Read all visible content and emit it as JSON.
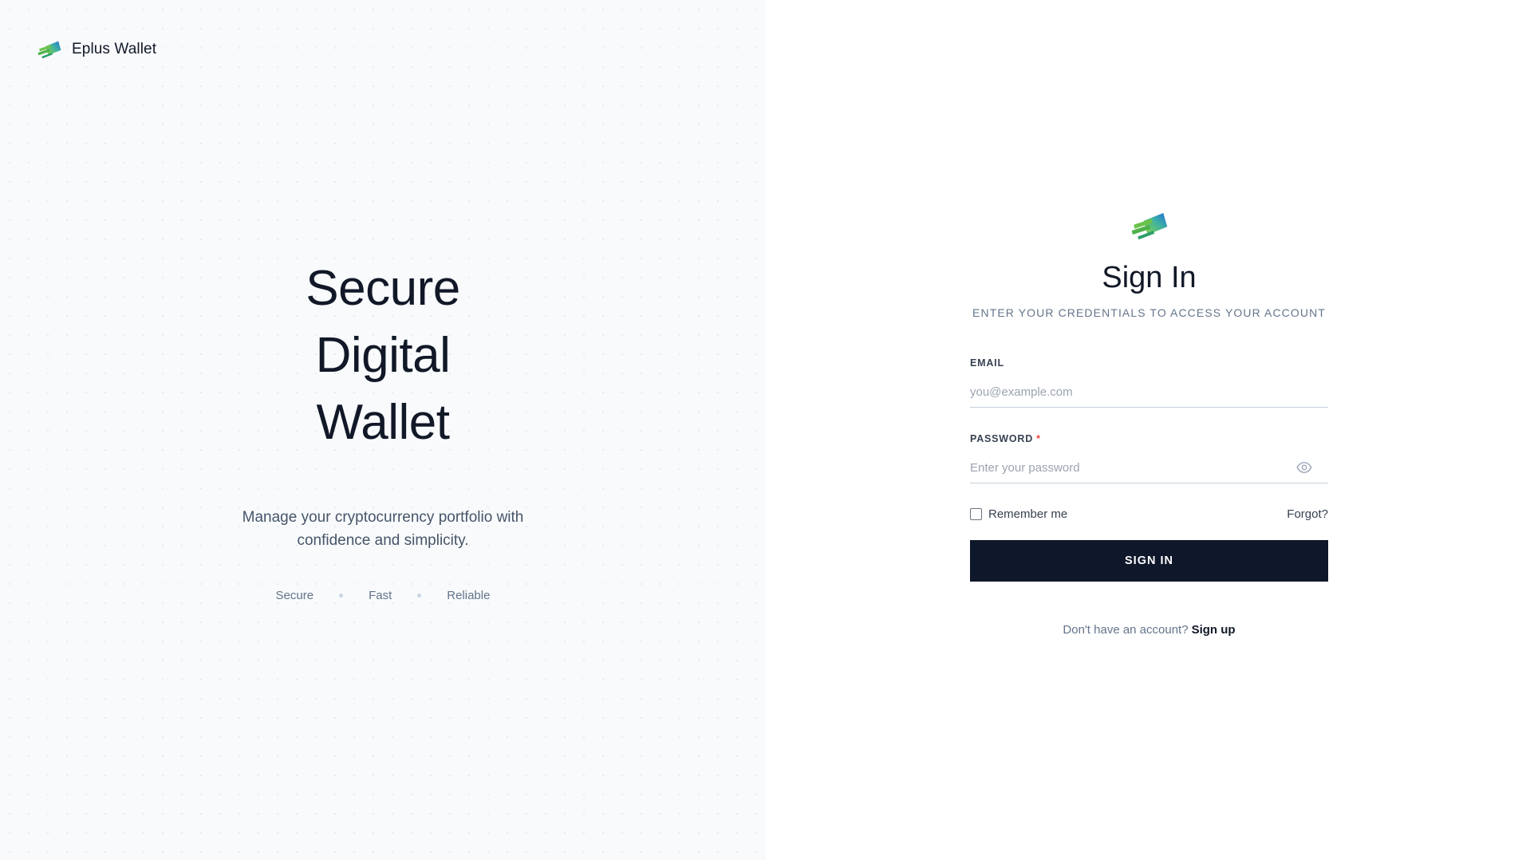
{
  "brand": {
    "name": "Eplus Wallet",
    "logo_icon": "wallet-logo-icon",
    "colors": {
      "green": "#6cc24a",
      "blue": "#1e6fd9",
      "dark": "#0f172a"
    }
  },
  "hero": {
    "title_lines": [
      "Secure",
      "Digital",
      "Wallet"
    ],
    "subtitle": "Manage your cryptocurrency portfolio with confidence and simplicity.",
    "features": [
      "Secure",
      "Fast",
      "Reliable"
    ]
  },
  "signin": {
    "title": "Sign In",
    "subtitle": "ENTER YOUR CREDENTIALS TO ACCESS YOUR ACCOUNT",
    "email": {
      "label": "EMAIL",
      "placeholder": "you@example.com",
      "value": ""
    },
    "password": {
      "label": "PASSWORD",
      "required_mark": "*",
      "placeholder": "Enter your password",
      "value": "",
      "toggle_icon": "eye-icon"
    },
    "remember_label": "Remember me",
    "forgot_label": "Forgot?",
    "submit_label": "SIGN IN",
    "signup_prompt": "Don't have an account?",
    "signup_link": "Sign up"
  }
}
